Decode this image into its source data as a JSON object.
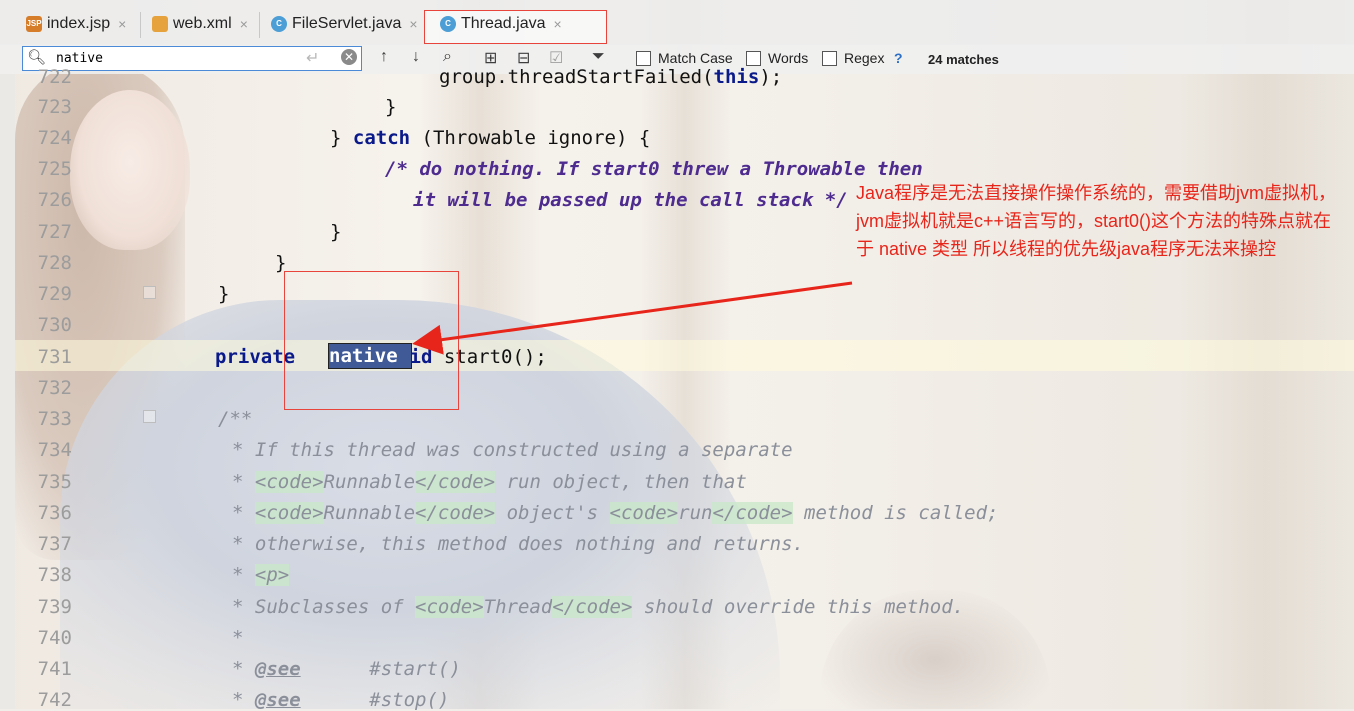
{
  "tabs": [
    {
      "label": "index.jsp",
      "icon": "jsp-file-icon",
      "badge": "JSP"
    },
    {
      "label": "web.xml",
      "icon": "xml-file-icon"
    },
    {
      "label": "FileServlet.java",
      "icon": "java-class-icon",
      "badge": "C"
    },
    {
      "label": "Thread.java",
      "icon": "java-class-icon",
      "badge": "C",
      "active": true
    }
  ],
  "tab_close": "×",
  "search": {
    "value": "native",
    "options": {
      "match_case": "Match Case",
      "words": "Words",
      "regex": "Regex",
      "help": "?"
    },
    "matches": "24 matches"
  },
  "lines": [
    {
      "n": "722",
      "text": "group.threadStartFailed(this);"
    },
    {
      "n": "723",
      "text": "}"
    },
    {
      "n": "724",
      "text": "} catch (Throwable ignore) {"
    },
    {
      "n": "725",
      "text": "/* do nothing. If start0 threw a Throwable then"
    },
    {
      "n": "726",
      "text": "it will be passed up the call stack */"
    },
    {
      "n": "727",
      "text": "}"
    },
    {
      "n": "728",
      "text": "}"
    },
    {
      "n": "729",
      "text": "}"
    },
    {
      "n": "730",
      "text": ""
    },
    {
      "n": "731",
      "text": "private native void start0();"
    },
    {
      "n": "732",
      "text": ""
    },
    {
      "n": "733",
      "text": "/**"
    },
    {
      "n": "734",
      "text": "* If this thread was constructed using a separate"
    },
    {
      "n": "735",
      "text": "* <code>Runnable</code> run object, then that"
    },
    {
      "n": "736",
      "text": "* <code>Runnable</code> object's <code>run</code> method is called;"
    },
    {
      "n": "737",
      "text": "* otherwise, this method does nothing and returns."
    },
    {
      "n": "738",
      "text": "* <p>"
    },
    {
      "n": "739",
      "text": "* Subclasses of <code>Thread</code> should override this method."
    },
    {
      "n": "740",
      "text": "*"
    },
    {
      "n": "741",
      "text": "* @see #start()"
    },
    {
      "n": "742",
      "text": "* @see #stop()"
    }
  ],
  "annotation": "Java程序是无法直接操作操作系统的，需要借助jvm虚拟机，jvm虚拟机就是c++语言写的，start0()这个方法的特殊点就在于 native 类型  所以线程的优先级java程序无法来操控",
  "colors": {
    "annotation": "#e8251a",
    "highlight": "#3f5a97",
    "keyword": "#0a1a8a"
  }
}
